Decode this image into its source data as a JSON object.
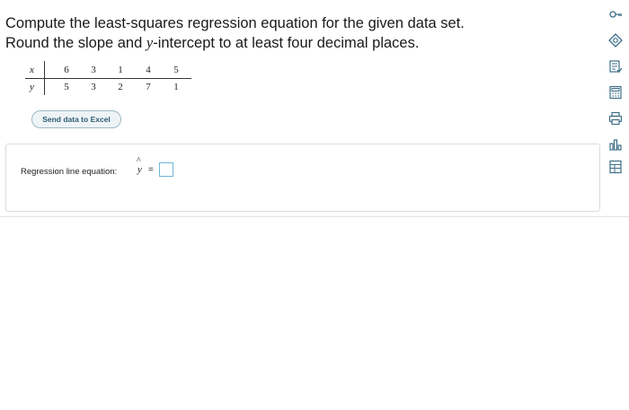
{
  "question": {
    "line1": "Compute the least-squares regression equation for the given data set.",
    "line2_a": "Round the slope and ",
    "line2_var": "y",
    "line2_b": "-intercept to at least four decimal places."
  },
  "table": {
    "x_header": "x",
    "y_header": "y",
    "x_values": [
      "6",
      "3",
      "1",
      "4",
      "5"
    ],
    "y_values": [
      "5",
      "3",
      "2",
      "7",
      "1"
    ]
  },
  "excel_button": "Send data to Excel",
  "answer": {
    "label": "Regression line equation:",
    "yhat": "y",
    "hat": "^",
    "equals": "="
  },
  "toolbar_icons": [
    "key-icon",
    "target-icon",
    "checklist-icon",
    "calculator-icon",
    "print-icon",
    "chart-icon",
    "table-icon"
  ]
}
